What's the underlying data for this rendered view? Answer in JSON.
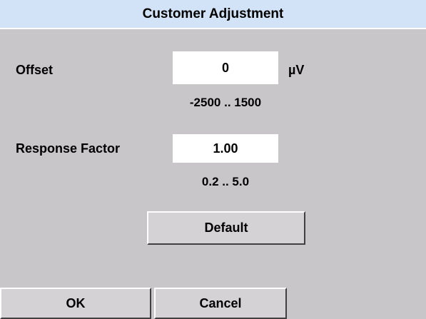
{
  "window": {
    "title": "Customer Adjustment"
  },
  "offset": {
    "label": "Offset",
    "value": "0",
    "unit": "µV",
    "range": "-2500 .. 1500"
  },
  "response_factor": {
    "label": "Response Factor",
    "value": "1.00",
    "range": "0.2 .. 5.0"
  },
  "buttons": {
    "default_label": "Default",
    "ok_label": "OK",
    "cancel_label": "Cancel"
  }
}
